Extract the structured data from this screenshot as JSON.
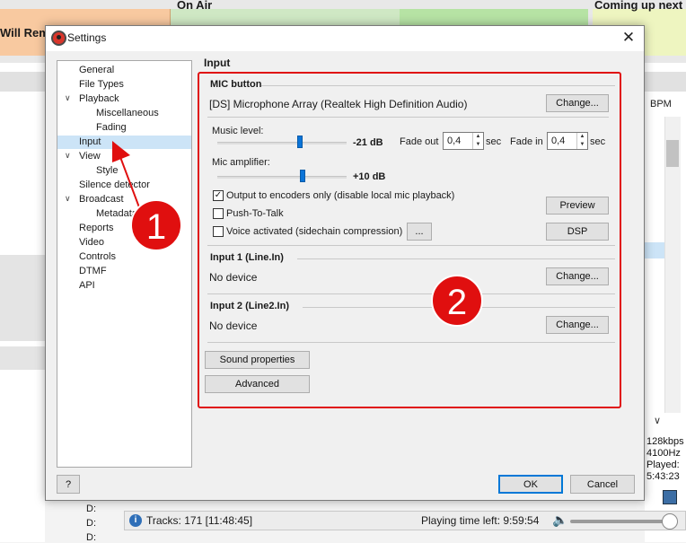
{
  "background": {
    "left_title": "Will Rem",
    "on_air": "On Air",
    "coming_up": "Coming up next",
    "right_col_header": "BPM",
    "stream_info": [
      "128kbps",
      "4100Hz",
      "Played:",
      "5:43:23"
    ],
    "drives": [
      "D:",
      "D:",
      "D:"
    ],
    "status": {
      "tracks": "Tracks: 171 [11:48:45]",
      "playing_time_left": "Playing time left: 9:59:54"
    }
  },
  "dialog": {
    "title": "Settings",
    "close_glyph": "✕",
    "help_label": "?",
    "ok_label": "OK",
    "cancel_label": "Cancel"
  },
  "tree": {
    "items": [
      {
        "label": "General",
        "level": 0
      },
      {
        "label": "File Types",
        "level": 0
      },
      {
        "label": "Playback",
        "level": 0,
        "expanded": true
      },
      {
        "label": "Miscellaneous",
        "level": 1
      },
      {
        "label": "Fading",
        "level": 1
      },
      {
        "label": "Input",
        "level": 0,
        "selected": true
      },
      {
        "label": "View",
        "level": 0,
        "expanded": true
      },
      {
        "label": "Style",
        "level": 1
      },
      {
        "label": "Silence detector",
        "level": 0
      },
      {
        "label": "Broadcast",
        "level": 0,
        "expanded": true
      },
      {
        "label": "Metadata",
        "level": 1
      },
      {
        "label": "Reports",
        "level": 0
      },
      {
        "label": "Video",
        "level": 0
      },
      {
        "label": "Controls",
        "level": 0
      },
      {
        "label": "DTMF",
        "level": 0
      },
      {
        "label": "API",
        "level": 0
      }
    ],
    "expand_glyph": "∨"
  },
  "panel": {
    "title": "Input",
    "mic": {
      "header": "MIC button",
      "device": "[DS] Microphone Array (Realtek High Definition Audio)",
      "change_label": "Change...",
      "music_level_label": "Music level:",
      "music_level_value": "-21 dB",
      "music_level_fraction": 0.64,
      "fade_out_label": "Fade out",
      "fade_out_value": "0,4",
      "fade_in_label": "Fade in",
      "fade_in_value": "0,4",
      "sec_label": "sec",
      "mic_amp_label": "Mic amplifier:",
      "mic_amp_value": "+10 dB",
      "mic_amp_fraction": 0.66,
      "output_encoders_label": "Output to encoders only (disable local mic playback)",
      "output_encoders_checked": true,
      "push_to_talk_label": "Push-To-Talk",
      "push_to_talk_checked": false,
      "voice_activated_label": "Voice activated (sidechain compression)",
      "voice_activated_checked": false,
      "dots_label": "...",
      "preview_label": "Preview",
      "dsp_label": "DSP"
    },
    "input1": {
      "header": "Input 1 (Line.In)",
      "device": "No device",
      "change_label": "Change..."
    },
    "input2": {
      "header": "Input 2 (Line2.In)",
      "device": "No device",
      "change_label": "Change..."
    },
    "sound_properties_label": "Sound properties",
    "advanced_label": "Advanced"
  },
  "annotations": {
    "marker1": "1",
    "marker2": "2",
    "color": "#e00f0f"
  }
}
